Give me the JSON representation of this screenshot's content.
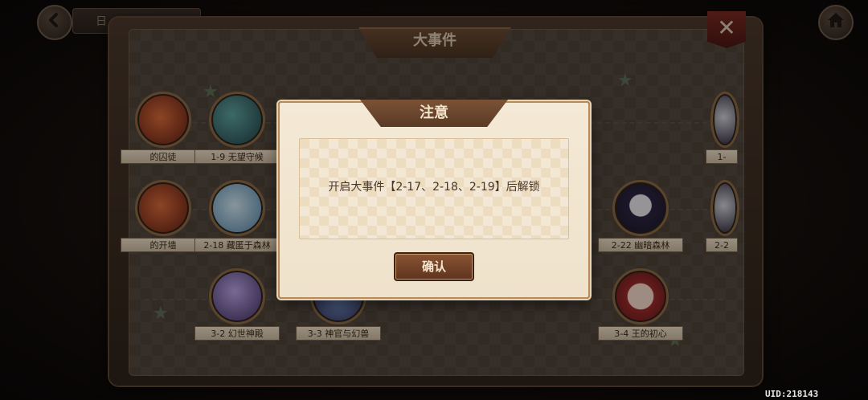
{
  "header": {
    "back_tab_label": "日",
    "back_icon": "arrow-left-icon",
    "home_icon": "home-icon"
  },
  "panel": {
    "title": "大事件",
    "close_glyph": "✕"
  },
  "nodes": [
    {
      "id": "prisoner",
      "label": "的囚徒",
      "style": "c-red"
    },
    {
      "id": "1-9",
      "label": "1-9 无望守候",
      "style": "c-teal"
    },
    {
      "id": "1-x",
      "label": "1-",
      "style": "c-dark"
    },
    {
      "id": "open",
      "label": "的开墙",
      "style": "c-red"
    },
    {
      "id": "2-18",
      "label": "2-18 藏匿于森林",
      "style": "c-blue"
    },
    {
      "id": "2-22",
      "label": "2-22 幽暗森林",
      "style": "c-skull"
    },
    {
      "id": "2-2x",
      "label": "2-2",
      "style": "c-dark"
    },
    {
      "id": "3-2",
      "label": "3-2 幻世神殿",
      "style": "c-purple"
    },
    {
      "id": "3-3",
      "label": "3-3 神官与幻兽",
      "style": "c-shaman"
    },
    {
      "id": "3-4",
      "label": "3-4 王的初心",
      "style": "c-maid"
    }
  ],
  "modal": {
    "title": "注意",
    "message": "开启大事件【2-17、2-18、2-19】后解锁",
    "confirm_label": "确认"
  },
  "footer": {
    "uid": "UID:218143"
  }
}
